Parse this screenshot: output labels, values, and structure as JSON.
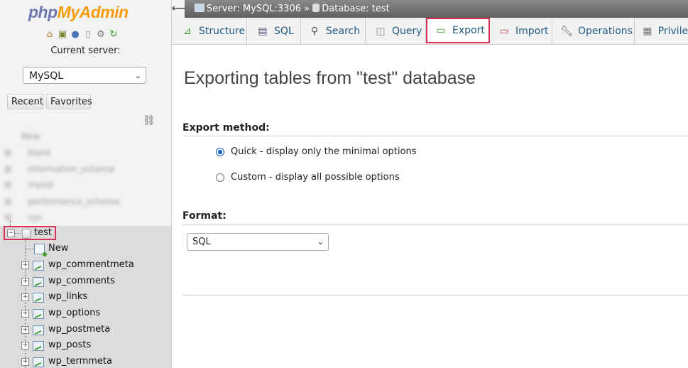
{
  "logo": {
    "part1": "php",
    "part2": "MyAdmin"
  },
  "nav_icons": [
    "home-icon",
    "exit-icon",
    "help-icon",
    "docs-icon",
    "settings-icon",
    "reload-icon"
  ],
  "current_server_label": "Current server:",
  "server_select": {
    "value": "MySQL"
  },
  "nav_buttons": {
    "recent": "Recent",
    "favorites": "Favorites"
  },
  "blurred_databases": [
    "New",
    "blank",
    "information_schema",
    "mysql",
    "performance_schema",
    "sys"
  ],
  "tree": {
    "database": "test",
    "new_label": "New",
    "tables": [
      "wp_commentmeta",
      "wp_comments",
      "wp_links",
      "wp_options",
      "wp_postmeta",
      "wp_posts",
      "wp_termmeta"
    ]
  },
  "breadcrumb": {
    "server": "Server: MySQL:3306",
    "sep": "»",
    "database": "Database: test"
  },
  "tabs": [
    {
      "label": "Structure",
      "icon": "structure-icon"
    },
    {
      "label": "SQL",
      "icon": "sql-icon"
    },
    {
      "label": "Search",
      "icon": "search-icon"
    },
    {
      "label": "Query",
      "icon": "query-icon"
    },
    {
      "label": "Export",
      "icon": "export-icon",
      "active": true
    },
    {
      "label": "Import",
      "icon": "import-icon"
    },
    {
      "label": "Operations",
      "icon": "operations-icon"
    },
    {
      "label": "Privileges",
      "icon": "privileges-icon"
    }
  ],
  "main": {
    "title": "Exporting tables from \"test\" database",
    "export_method_heading": "Export method:",
    "method_quick": "Quick - display only the minimal options",
    "method_custom": "Custom - display all possible options",
    "format_heading": "Format:",
    "format_value": "SQL"
  },
  "colors": {
    "accent": "#235a81",
    "highlight": "#d8305a",
    "radio": "#0b5bd3"
  }
}
